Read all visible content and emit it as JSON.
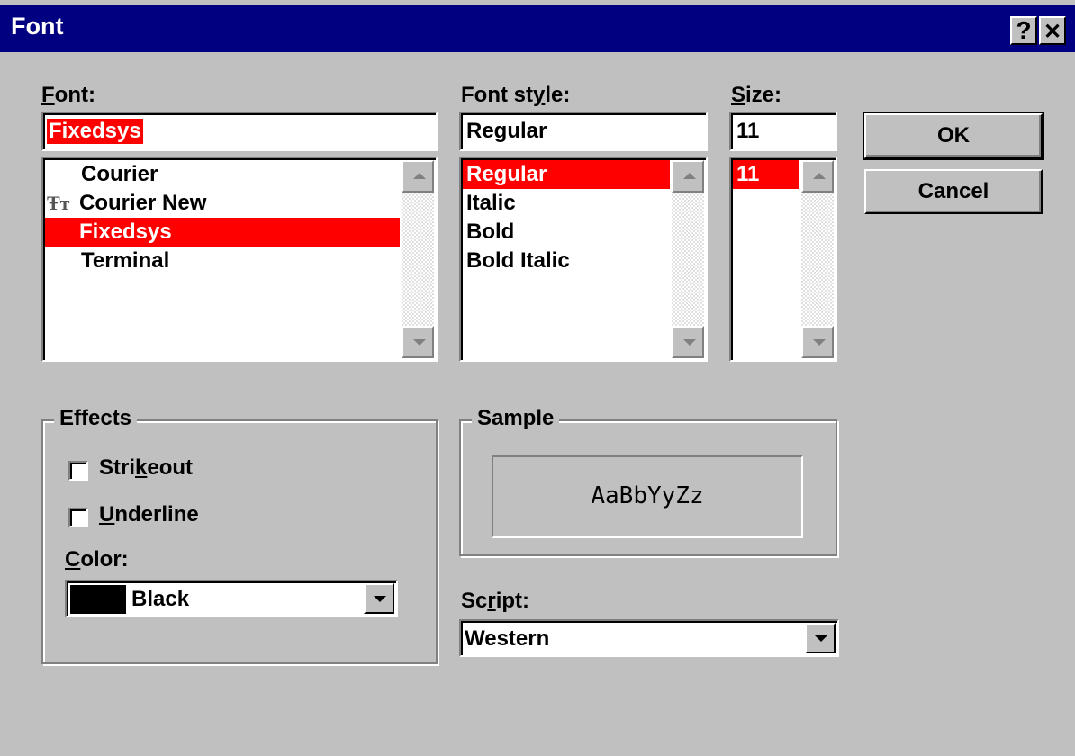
{
  "window": {
    "title": "Font",
    "help_label": "?",
    "close_label": "✕"
  },
  "font": {
    "label_prefix": "",
    "label_mnemonic": "F",
    "label_rest": "ont:",
    "value": "Fixedsys",
    "items": [
      {
        "label": "Courier",
        "icon": ""
      },
      {
        "label": "Courier New",
        "icon": "truetype-icon"
      },
      {
        "label": "Fixedsys",
        "icon": "",
        "selected": true
      },
      {
        "label": "Terminal",
        "icon": ""
      }
    ]
  },
  "style": {
    "label_prefix": "Font st",
    "label_mnemonic": "y",
    "label_rest": "le:",
    "value": "Regular",
    "items": [
      {
        "label": "Regular",
        "selected": true
      },
      {
        "label": "Italic"
      },
      {
        "label": "Bold"
      },
      {
        "label": "Bold Italic"
      }
    ]
  },
  "size": {
    "label_prefix": "",
    "label_mnemonic": "S",
    "label_rest": "ize:",
    "value": "11",
    "items": [
      {
        "label": "11",
        "selected": true
      }
    ]
  },
  "buttons": {
    "ok": "OK",
    "cancel": "Cancel"
  },
  "effects": {
    "title": "Effects",
    "strikeout_prefix": "Stri",
    "strikeout_mnemonic": "k",
    "strikeout_rest": "eout",
    "underline_prefix": "",
    "underline_mnemonic": "U",
    "underline_rest": "nderline",
    "strikeout_checked": false,
    "underline_checked": false,
    "color_prefix": "",
    "color_mnemonic": "C",
    "color_rest": "olor:",
    "color_value": "Black",
    "color_swatch": "#000000"
  },
  "sample": {
    "title": "Sample",
    "text": "AaBbYyZz"
  },
  "script": {
    "label_prefix": "Sc",
    "label_mnemonic": "r",
    "label_rest": "ipt:",
    "value": "Western"
  },
  "colors": {
    "titlebar": "#000080",
    "selection": "#ff0000",
    "face": "#c0c0c0"
  }
}
